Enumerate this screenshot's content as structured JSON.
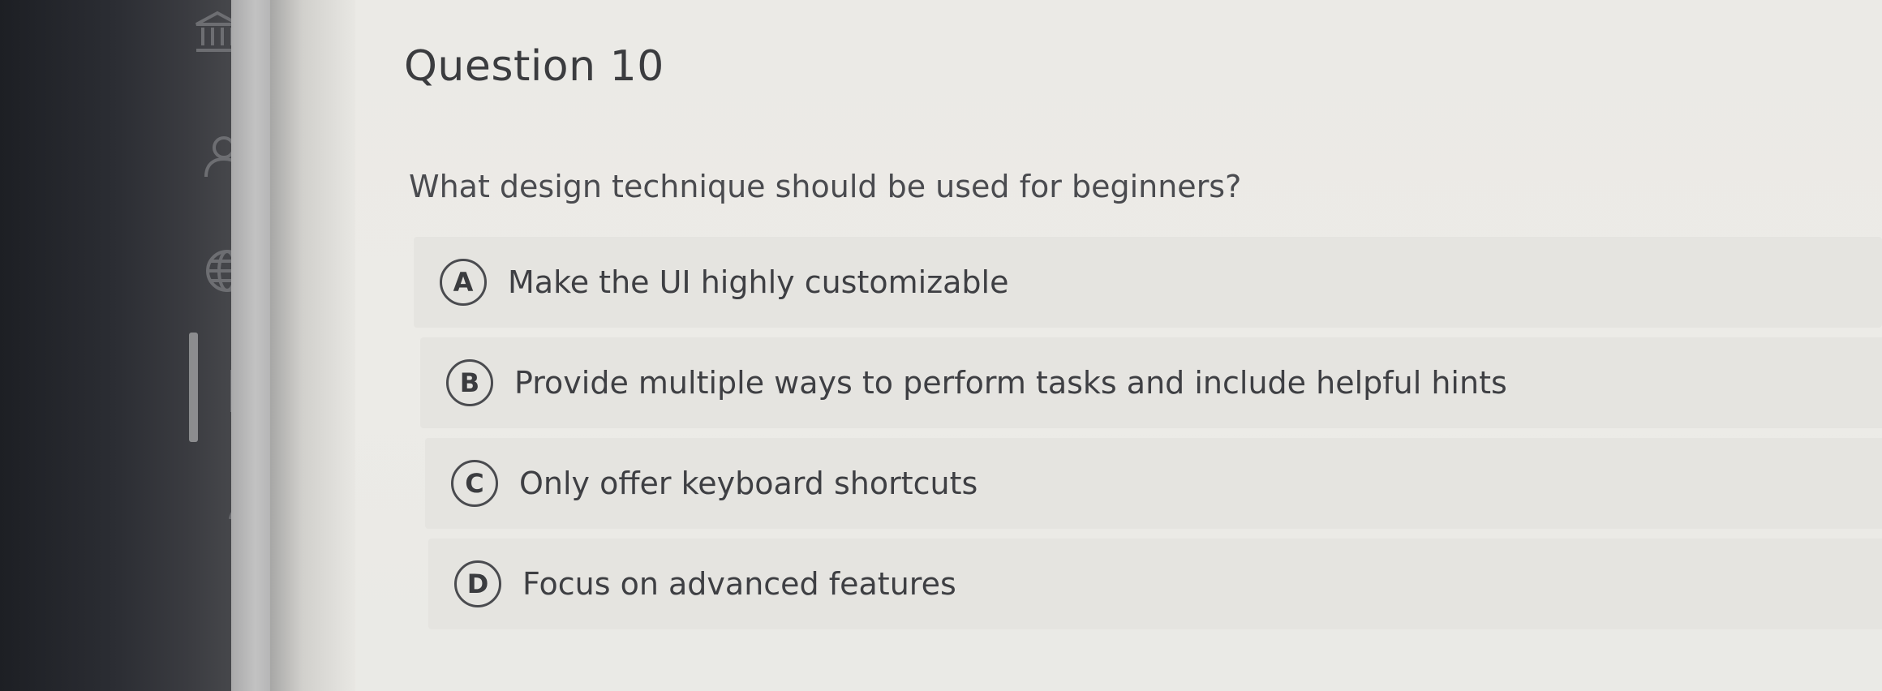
{
  "nav": {
    "icons": [
      {
        "name": "institution-icon"
      },
      {
        "name": "account-icon"
      },
      {
        "name": "globe-icon"
      },
      {
        "name": "courses-icon"
      },
      {
        "name": "groups-icon"
      },
      {
        "name": "calendar-icon"
      }
    ]
  },
  "question": {
    "title": "Question 10",
    "prompt": "What design technique should be used for beginners?",
    "options": [
      {
        "letter": "A",
        "text": "Make the UI highly customizable"
      },
      {
        "letter": "B",
        "text": "Provide multiple ways to perform tasks and include helpful hints"
      },
      {
        "letter": "C",
        "text": "Only offer keyboard shortcuts"
      },
      {
        "letter": "D",
        "text": "Focus on advanced features"
      }
    ]
  }
}
